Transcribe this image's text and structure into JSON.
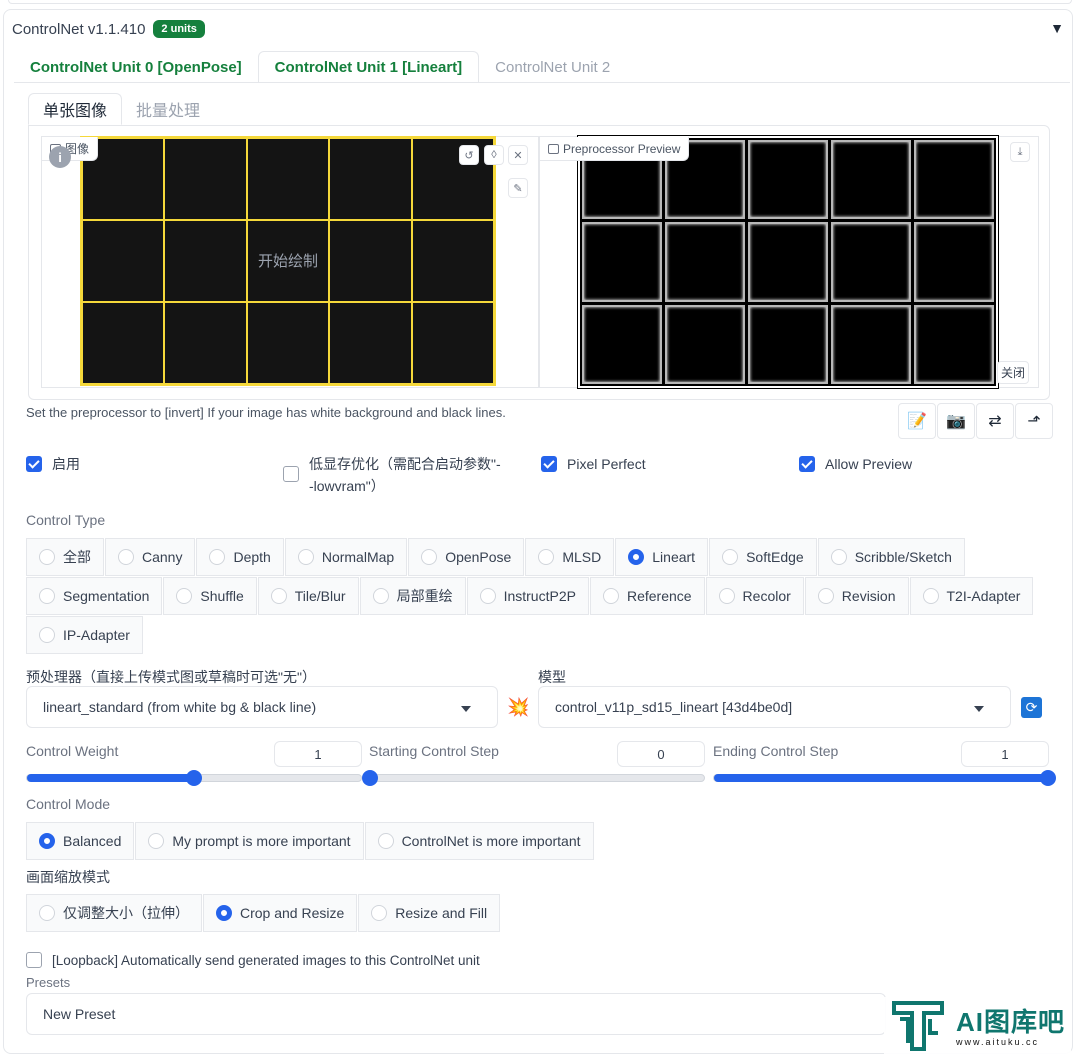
{
  "header": {
    "title": "ControlNet v1.1.410",
    "badge": "2 units",
    "collapse_icon": "triangle-down-icon"
  },
  "tabs": [
    {
      "label": "ControlNet Unit 0 [OpenPose]",
      "active": false
    },
    {
      "label": "ControlNet Unit 1 [Lineart]",
      "active": true
    },
    {
      "label": "ControlNet Unit 2",
      "active": false
    }
  ],
  "subtabs": [
    {
      "label": "单张图像",
      "active": true
    },
    {
      "label": "批量处理",
      "active": false
    }
  ],
  "image_input": {
    "label": "图像",
    "center_text": "开始绘制",
    "canvas_color": "#141414",
    "grid_color": "#f5d83a"
  },
  "preview": {
    "label": "Preprocessor Preview",
    "close_label": "关闭"
  },
  "hint": "Set the preprocessor to [invert] If your image has white background and black lines.",
  "toolbar_icons": [
    "edit-icon",
    "camera-icon",
    "swap-icon",
    "send-icon"
  ],
  "checkboxes": {
    "enable": {
      "label": "启用",
      "checked": true
    },
    "lowvram": {
      "label_line1": "低显存优化（需配合启动参数\"-",
      "label_line2": "-lowvram\"）",
      "checked": false
    },
    "pixel_perfect": {
      "label": "Pixel Perfect",
      "checked": true
    },
    "allow_preview": {
      "label": "Allow Preview",
      "checked": true
    }
  },
  "control_type": {
    "label": "Control Type",
    "options": [
      "全部",
      "Canny",
      "Depth",
      "NormalMap",
      "OpenPose",
      "MLSD",
      "Lineart",
      "SoftEdge",
      "Scribble/Sketch",
      "Segmentation",
      "Shuffle",
      "Tile/Blur",
      "局部重绘",
      "InstructP2P",
      "Reference",
      "Recolor",
      "Revision",
      "T2I-Adapter",
      "IP-Adapter"
    ],
    "selected": "Lineart"
  },
  "preprocessor": {
    "label": "预处理器（直接上传模式图或草稿时可选\"无\"）",
    "value": "lineart_standard (from white bg & black line)"
  },
  "model": {
    "label": "模型",
    "value": "control_v11p_sd15_lineart [43d4be0d]"
  },
  "sliders": {
    "weight": {
      "label": "Control Weight",
      "value": "1",
      "fraction": 0.5
    },
    "start": {
      "label": "Starting Control Step",
      "value": "0",
      "fraction": 0.0
    },
    "end": {
      "label": "Ending Control Step",
      "value": "1",
      "fraction": 1.0
    }
  },
  "control_mode": {
    "label": "Control Mode",
    "options": [
      "Balanced",
      "My prompt is more important",
      "ControlNet is more important"
    ],
    "selected": "Balanced"
  },
  "resize_mode": {
    "label": "画面缩放模式",
    "options": [
      "仅调整大小（拉伸）",
      "Crop and Resize",
      "Resize and Fill"
    ],
    "selected": "Crop and Resize"
  },
  "loopback": {
    "label": "[Loopback] Automatically send generated images to this ControlNet unit",
    "checked": false
  },
  "presets": {
    "label": "Presets",
    "value": "New Preset"
  },
  "watermark": {
    "main": "AI图库吧",
    "url": "www.aituku.cc"
  },
  "colors": {
    "accent": "#2563eb",
    "badge": "#15803d",
    "tab_green": "#15803d"
  }
}
